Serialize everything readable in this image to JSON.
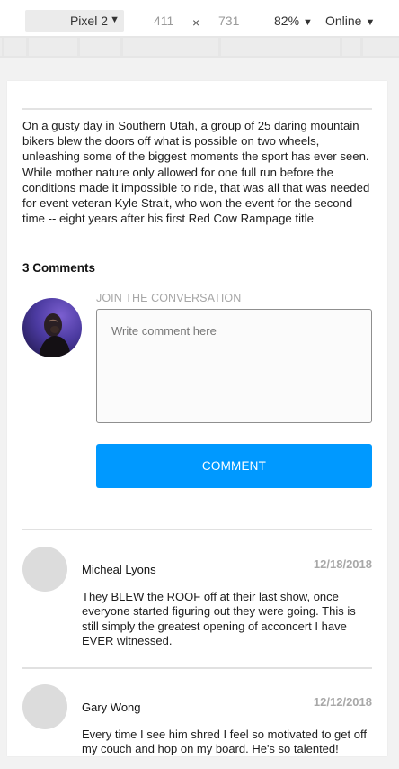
{
  "devtools": {
    "device": "Pixel 2",
    "width": "411",
    "times": "×",
    "height": "731",
    "zoom": "82%",
    "network": "Online"
  },
  "article": {
    "body": "On a gusty day in Southern Utah, a group of 25 daring mountain bikers blew the doors off what is possible on two wheels, unleashing some of the biggest moments the sport has ever seen. While mother nature only allowed for one full run before the conditions made it impossible to ride, that was all that was needed for event veteran Kyle Strait, who won the event for the second time -- eight years after his first Red Cow Rampage title"
  },
  "comments_section": {
    "count_label": "3 Comments",
    "join_label": "JOIN THE CONVERSATION",
    "placeholder": "Write comment here",
    "button_label": "COMMENT"
  },
  "comments": [
    {
      "name": "Micheal Lyons",
      "date": "12/18/2018",
      "text": "They BLEW the ROOF off at their last show, once everyone started figuring out they were going. This is still simply the greatest opening of acconcert I have EVER witnessed."
    },
    {
      "name": "Gary Wong",
      "date": "12/12/2018",
      "text": "Every time I see him shred I feel so motivated to get off my couch and hop on my board. He's so talented!"
    }
  ],
  "colors": {
    "accent": "#0099ff",
    "avatar_placeholder": "#dcdcdc"
  }
}
